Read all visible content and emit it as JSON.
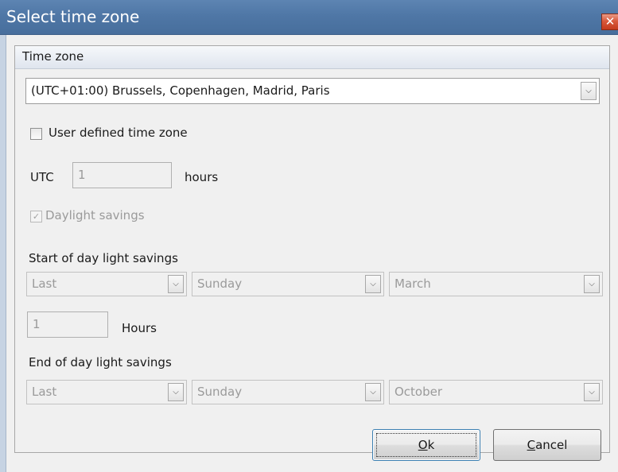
{
  "window": {
    "title": "Select time zone",
    "close_glyph": "✕"
  },
  "group": {
    "header": "Time zone"
  },
  "timezone": {
    "selected": "(UTC+01:00) Brussels, Copenhagen, Madrid, Paris"
  },
  "user_defined": {
    "label": "User defined time zone",
    "checked": false
  },
  "utc": {
    "label": "UTC",
    "value": "1",
    "unit": "hours"
  },
  "daylight": {
    "label": "Daylight savings",
    "checked": true,
    "enabled": false
  },
  "start": {
    "title": "Start of day light savings",
    "week": "Last",
    "day": "Sunday",
    "month": "March",
    "hours_value": "1",
    "hours_label": "Hours"
  },
  "end": {
    "title": "End of day light savings",
    "week": "Last",
    "day": "Sunday",
    "month": "October"
  },
  "buttons": {
    "ok": {
      "mnemonic": "O",
      "rest": "k"
    },
    "cancel": {
      "mnemonic": "C",
      "rest": "ancel"
    }
  },
  "icons": {
    "dropdown": "chevron-down-icon",
    "check": "checkmark-icon",
    "close": "close-icon"
  }
}
